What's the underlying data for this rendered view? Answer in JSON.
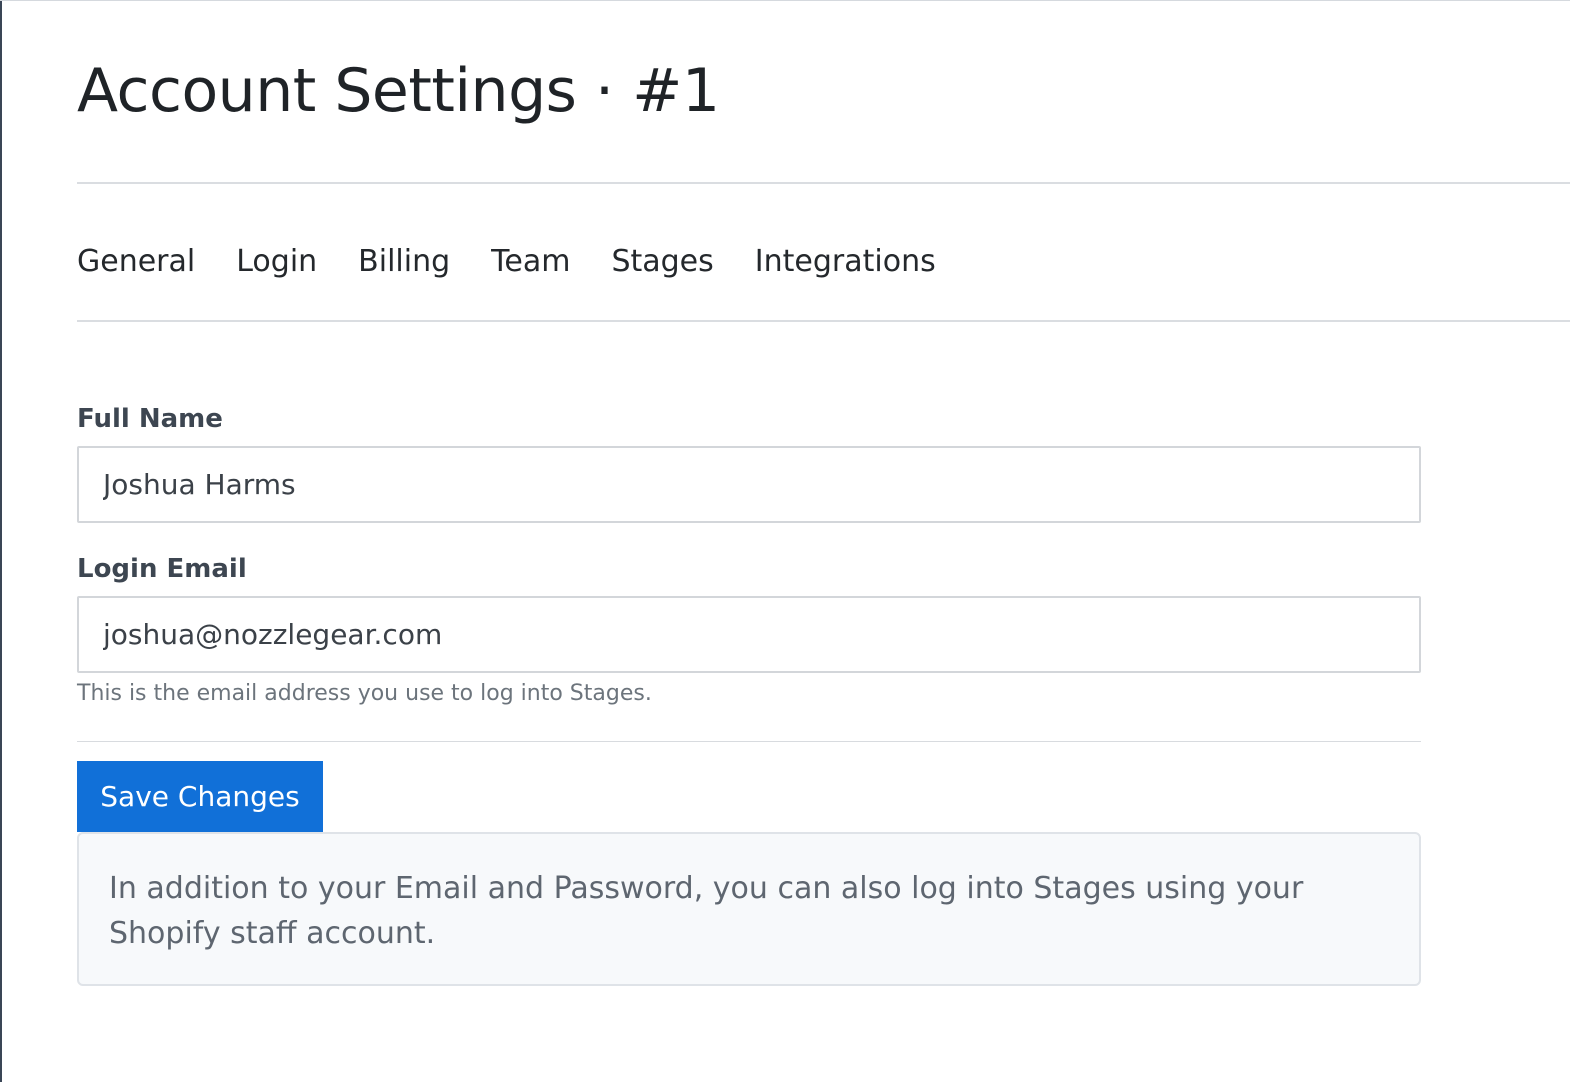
{
  "page": {
    "title": "Account Settings · #1"
  },
  "tabs": [
    {
      "label": "General"
    },
    {
      "label": "Login"
    },
    {
      "label": "Billing"
    },
    {
      "label": "Team"
    },
    {
      "label": "Stages"
    },
    {
      "label": "Integrations"
    }
  ],
  "form": {
    "full_name": {
      "label": "Full Name",
      "value": "Joshua Harms"
    },
    "login_email": {
      "label": "Login Email",
      "value": "joshua@nozzlegear.com",
      "help": "This is the email address you use to log into Stages."
    },
    "save_label": "Save Changes"
  },
  "info": {
    "text": "In addition to your Email and Password, you can also log into Stages using your Shopify staff account."
  },
  "colors": {
    "primary_button": "#1170d8",
    "info_background": "#f7f9fb"
  }
}
